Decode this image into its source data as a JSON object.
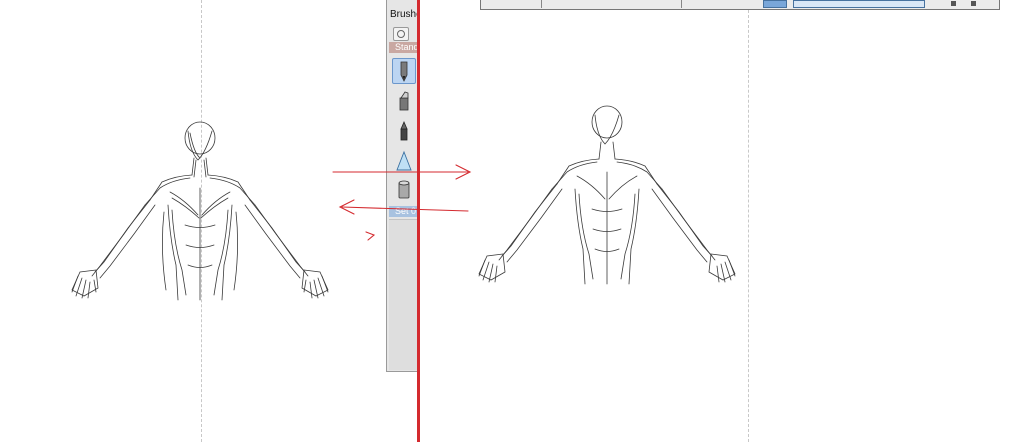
{
  "brushes_panel": {
    "title": "Brushe",
    "category_label": "Stand",
    "set_label": "Set 0",
    "tools": [
      {
        "name": "pencil-brush-icon",
        "selected": true
      },
      {
        "name": "marker-brush-icon",
        "selected": false
      },
      {
        "name": "pen-brush-icon",
        "selected": false
      },
      {
        "name": "triangle-brush-icon",
        "selected": false
      },
      {
        "name": "bucket-brush-icon",
        "selected": false
      }
    ]
  },
  "colors": {
    "annotation_red": "#d42a2f",
    "sketch_line": "#3a3a3a",
    "guide_line": "#c8c8c8",
    "selected_tool_bg": "#bcd5f2"
  },
  "canvas": {
    "left_figure": "figure-sketch-before",
    "right_figure": "figure-sketch-after"
  }
}
